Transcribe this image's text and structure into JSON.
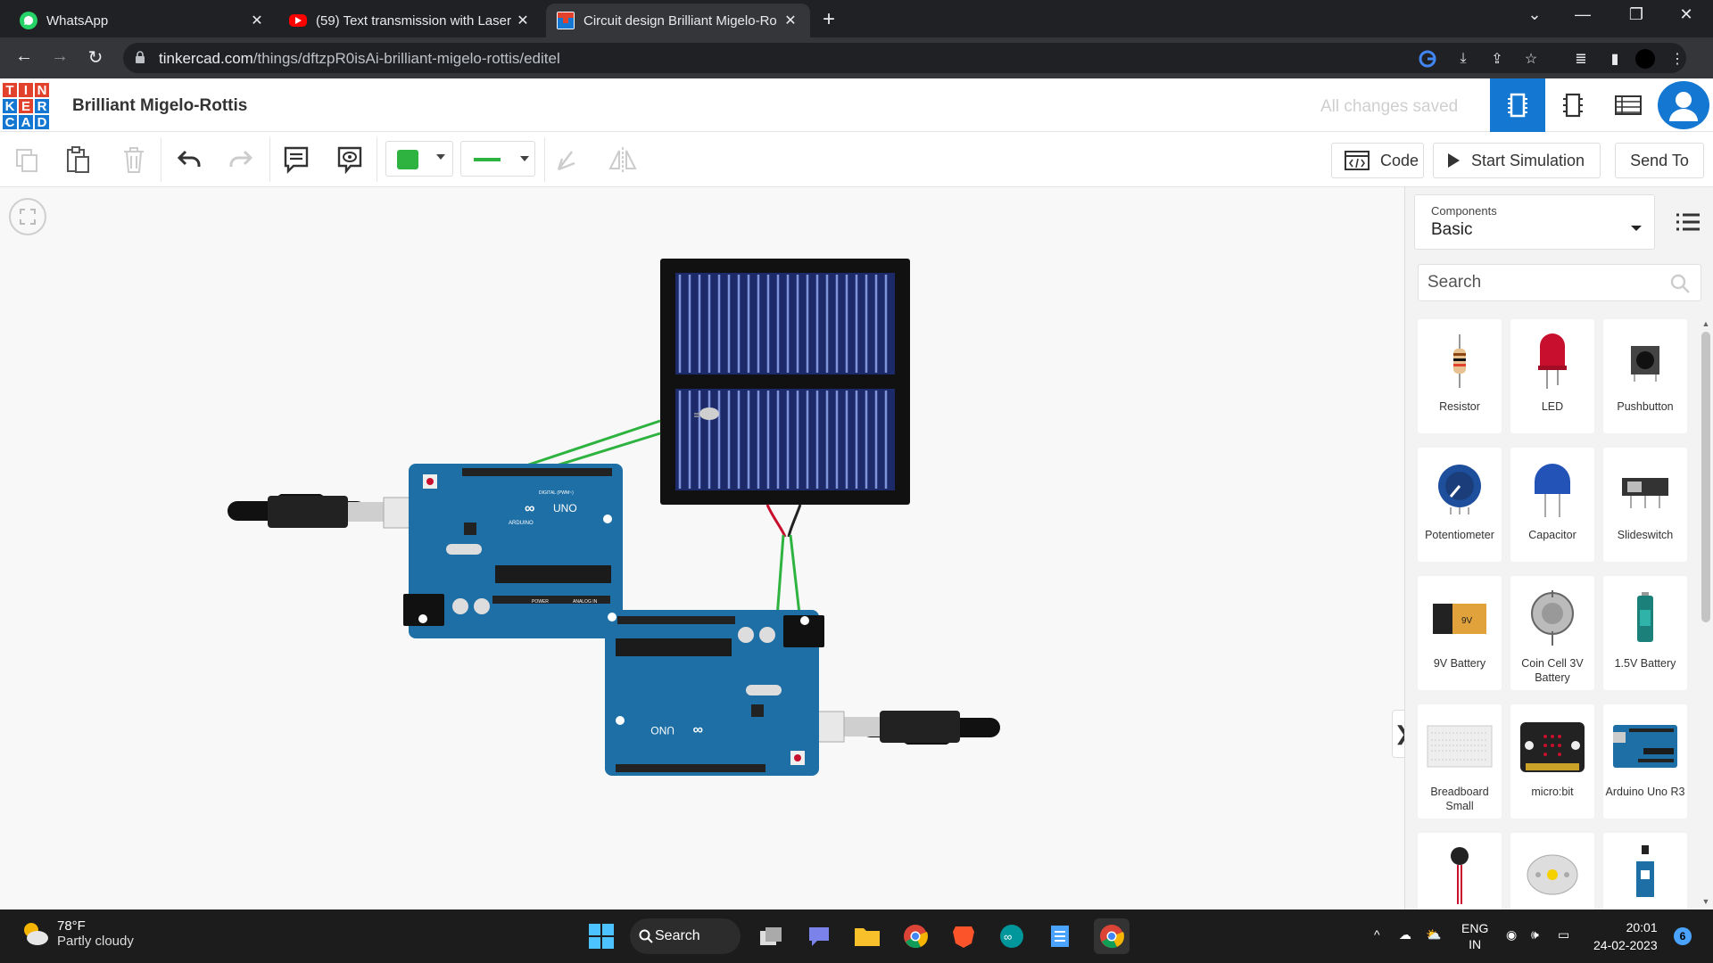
{
  "browser": {
    "tabs": [
      {
        "title": "WhatsApp",
        "active": false
      },
      {
        "title": "(59) Text transmission with Laser",
        "active": false
      },
      {
        "title": "Circuit design Brilliant Migelo-Ro",
        "active": true
      }
    ],
    "url_host": "tinkercad.com",
    "url_path": "/things/dftzpR0isAi-brilliant-migelo-rottis/editel"
  },
  "app": {
    "logo_letters": [
      "T",
      "I",
      "N",
      "K",
      "E",
      "R",
      "C",
      "A",
      "D"
    ],
    "logo_colors": [
      "#e2412b",
      "#e2412b",
      "#e2412b",
      "#1477d1",
      "#e2412b",
      "#1477d1",
      "#1477d1",
      "#1477d1",
      "#1477d1"
    ],
    "title": "Brilliant Migelo-Rottis",
    "save_status": "All changes saved",
    "accent": "#1477d1"
  },
  "toolbar": {
    "code_label": "Code",
    "start_sim_label": "Start Simulation",
    "send_to_label": "Send To",
    "wire_color": "#2eb340"
  },
  "components": {
    "select_label": "Components",
    "select_value": "Basic",
    "search_placeholder": "Search",
    "items": [
      {
        "name": "Resistor",
        "icon": "resistor-icon"
      },
      {
        "name": "LED",
        "icon": "led-icon"
      },
      {
        "name": "Pushbutton",
        "icon": "pushbutton-icon"
      },
      {
        "name": "Potentiometer",
        "icon": "potentiometer-icon"
      },
      {
        "name": "Capacitor",
        "icon": "capacitor-icon"
      },
      {
        "name": "Slideswitch",
        "icon": "slideswitch-icon"
      },
      {
        "name": "9V Battery",
        "icon": "battery-9v-icon"
      },
      {
        "name": "Coin Cell 3V Battery",
        "icon": "coin-cell-icon"
      },
      {
        "name": "1.5V Battery",
        "icon": "battery-aa-icon"
      },
      {
        "name": "Breadboard Small",
        "icon": "breadboard-icon"
      },
      {
        "name": "micro:bit",
        "icon": "microbit-icon"
      },
      {
        "name": "Arduino Uno R3",
        "icon": "arduino-icon"
      },
      {
        "name": "",
        "icon": "vibration-motor-icon"
      },
      {
        "name": "",
        "icon": "dc-motor-icon"
      },
      {
        "name": "",
        "icon": "servo-icon"
      }
    ]
  },
  "canvas": {
    "board_labels": {
      "uno": "UNO",
      "arduino": "ARDUINO",
      "digital": "DIGITAL (PWM~)",
      "power": "POWER",
      "analog": "ANALOG IN"
    }
  },
  "taskbar": {
    "temperature": "78°F",
    "weather": "Partly cloudy",
    "search_label": "Search",
    "lang1": "ENG",
    "lang2": "IN",
    "time": "20:01",
    "date": "24-02-2023",
    "notification_count": "6"
  }
}
